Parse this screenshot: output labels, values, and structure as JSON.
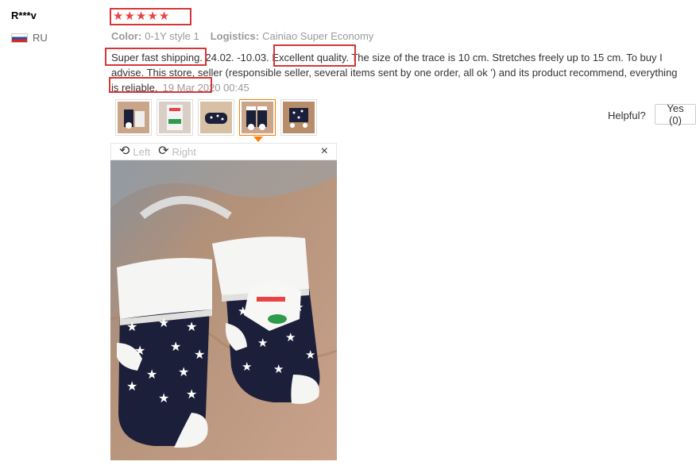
{
  "reviewer": {
    "name": "R***v",
    "country": "RU",
    "flag_icon": "russia-flag-icon"
  },
  "rating": {
    "stars": 5,
    "max": 5,
    "glyph": "★",
    "color": "#e94343"
  },
  "meta": {
    "color_label": "Color:",
    "color_value": "0-1Y style 1",
    "logistics_label": "Logistics:",
    "logistics_value": "Cainiao Super Economy"
  },
  "review": {
    "text_part1": "Super fast shipping",
    "text_part2": ". 24.02. -10.03. ",
    "text_part3": "Excellent quality",
    "text_part4": ". The size of the trace is 10 cm. Stretches freely up to 15 cm. To buy I advise. This store, seller (responsible seller, several items sent by one order, all ok ') and its product recommend, ",
    "text_part5": "everything is reliable",
    "text_part6": ".",
    "date": "19 Mar 2020 00:45"
  },
  "helpful": {
    "label": "Helpful?",
    "yes_label": "Yes (0)"
  },
  "viewer": {
    "left_label": "Left",
    "right_label": "Right",
    "close_glyph": "×",
    "rotate_left_glyph": "⟲",
    "rotate_right_glyph": "⟳"
  },
  "thumbnails": [
    {
      "name": "thumb-1"
    },
    {
      "name": "thumb-2"
    },
    {
      "name": "thumb-3"
    },
    {
      "name": "thumb-4",
      "active": true
    },
    {
      "name": "thumb-5"
    }
  ],
  "colors": {
    "highlight": "#d63638",
    "active": "#ff7e00",
    "sock_navy": "#1c1f3a"
  }
}
